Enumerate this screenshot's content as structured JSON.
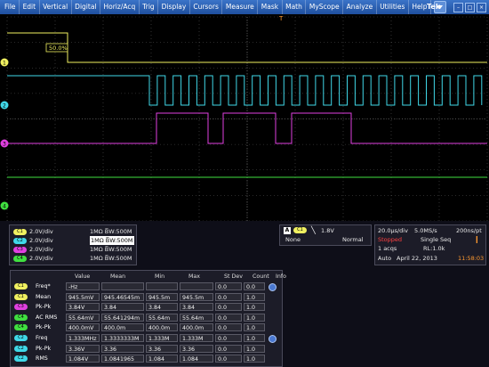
{
  "menu": {
    "items": [
      "File",
      "Edit",
      "Vertical",
      "Digital",
      "Horiz/Acq",
      "Trig",
      "Display",
      "Cursors",
      "Measure",
      "Mask",
      "Math",
      "MyScope",
      "Analyze",
      "Utilities",
      "Help"
    ],
    "brand": "Tek"
  },
  "window_buttons": [
    "–",
    "□",
    "×"
  ],
  "colors": {
    "ch1": "#f0f060",
    "ch2": "#40d8e8",
    "ch3": "#e040e0",
    "ch4": "#40e040",
    "stopped": "#ff4040",
    "time": "#ff9a30"
  },
  "scope": {
    "trigger_readout": "50.0%",
    "channel_markers": [
      "1",
      "2",
      "3",
      "4"
    ],
    "trigger_marker": "T"
  },
  "channels": [
    {
      "badge": "C1",
      "scale": "2.0V/div",
      "impedance": "1MΩ",
      "bandwidth": "B̅W:500M",
      "color": "#f0f060",
      "selected": false
    },
    {
      "badge": "C2",
      "scale": "2.0V/div",
      "impedance": "1MΩ",
      "bandwidth": "B̅W:500M",
      "color": "#40d8e8",
      "selected": true
    },
    {
      "badge": "C3",
      "scale": "2.0V/div",
      "impedance": "1MΩ",
      "bandwidth": "B̅W:500M",
      "color": "#e040e0",
      "selected": false
    },
    {
      "badge": "C4",
      "scale": "2.0V/div",
      "impedance": "1MΩ",
      "bandwidth": "B̅W:500M",
      "color": "#40e040",
      "selected": false
    }
  ],
  "trigger": {
    "mode_icon": "A",
    "source": "C1",
    "level": "1.8V",
    "coupling": "None",
    "sweep": "Normal"
  },
  "acquisition": {
    "horiz": "20.0µs/div",
    "sample_rate": "5.0MS/s",
    "resolution": "200ns/pt",
    "status": "Stopped",
    "mode": "Single Seq",
    "acqs": "1 acqs",
    "record_length": "RL:1.0k",
    "auto": "Auto",
    "date": "April 22, 2013",
    "time": "11:58:03"
  },
  "measurements": {
    "headers": [
      "Value",
      "Mean",
      "Min",
      "Max",
      "St Dev",
      "Count",
      "Info"
    ],
    "rows": [
      {
        "ch": "C1",
        "label": "Freq*",
        "value": "-Hz",
        "mean": "",
        "min": "",
        "max": "",
        "stdev": "0.0",
        "count": "0.0",
        "info": true
      },
      {
        "ch": "C1",
        "label": "Mean",
        "value": "945.5mV",
        "mean": "945.46545m",
        "min": "945.5m",
        "max": "945.5m",
        "stdev": "0.0",
        "count": "1.0",
        "info": false
      },
      {
        "ch": "C3",
        "label": "Pk-Pk",
        "value": "3.84V",
        "mean": "3.84",
        "min": "3.84",
        "max": "3.84",
        "stdev": "0.0",
        "count": "1.0",
        "info": false
      },
      {
        "ch": "C4",
        "label": "AC RMS",
        "value": "55.64mV",
        "mean": "55.641294m",
        "min": "55.64m",
        "max": "55.64m",
        "stdev": "0.0",
        "count": "1.0",
        "info": false
      },
      {
        "ch": "C4",
        "label": "Pk-Pk",
        "value": "400.0mV",
        "mean": "400.0m",
        "min": "400.0m",
        "max": "400.0m",
        "stdev": "0.0",
        "count": "1.0",
        "info": false
      },
      {
        "ch": "C2",
        "label": "Freq",
        "value": "1.333MHz",
        "mean": "1.3333333M",
        "min": "1.333M",
        "max": "1.333M",
        "stdev": "0.0",
        "count": "1.0",
        "info": true
      },
      {
        "ch": "C2",
        "label": "Pk-Pk",
        "value": "3.36V",
        "mean": "3.36",
        "min": "3.36",
        "max": "3.36",
        "stdev": "0.0",
        "count": "1.0",
        "info": false
      },
      {
        "ch": "C2",
        "label": "RMS",
        "value": "1.084V",
        "mean": "1.0841965",
        "min": "1.084",
        "max": "1.084",
        "stdev": "0.0",
        "count": "1.0",
        "info": false
      }
    ]
  }
}
